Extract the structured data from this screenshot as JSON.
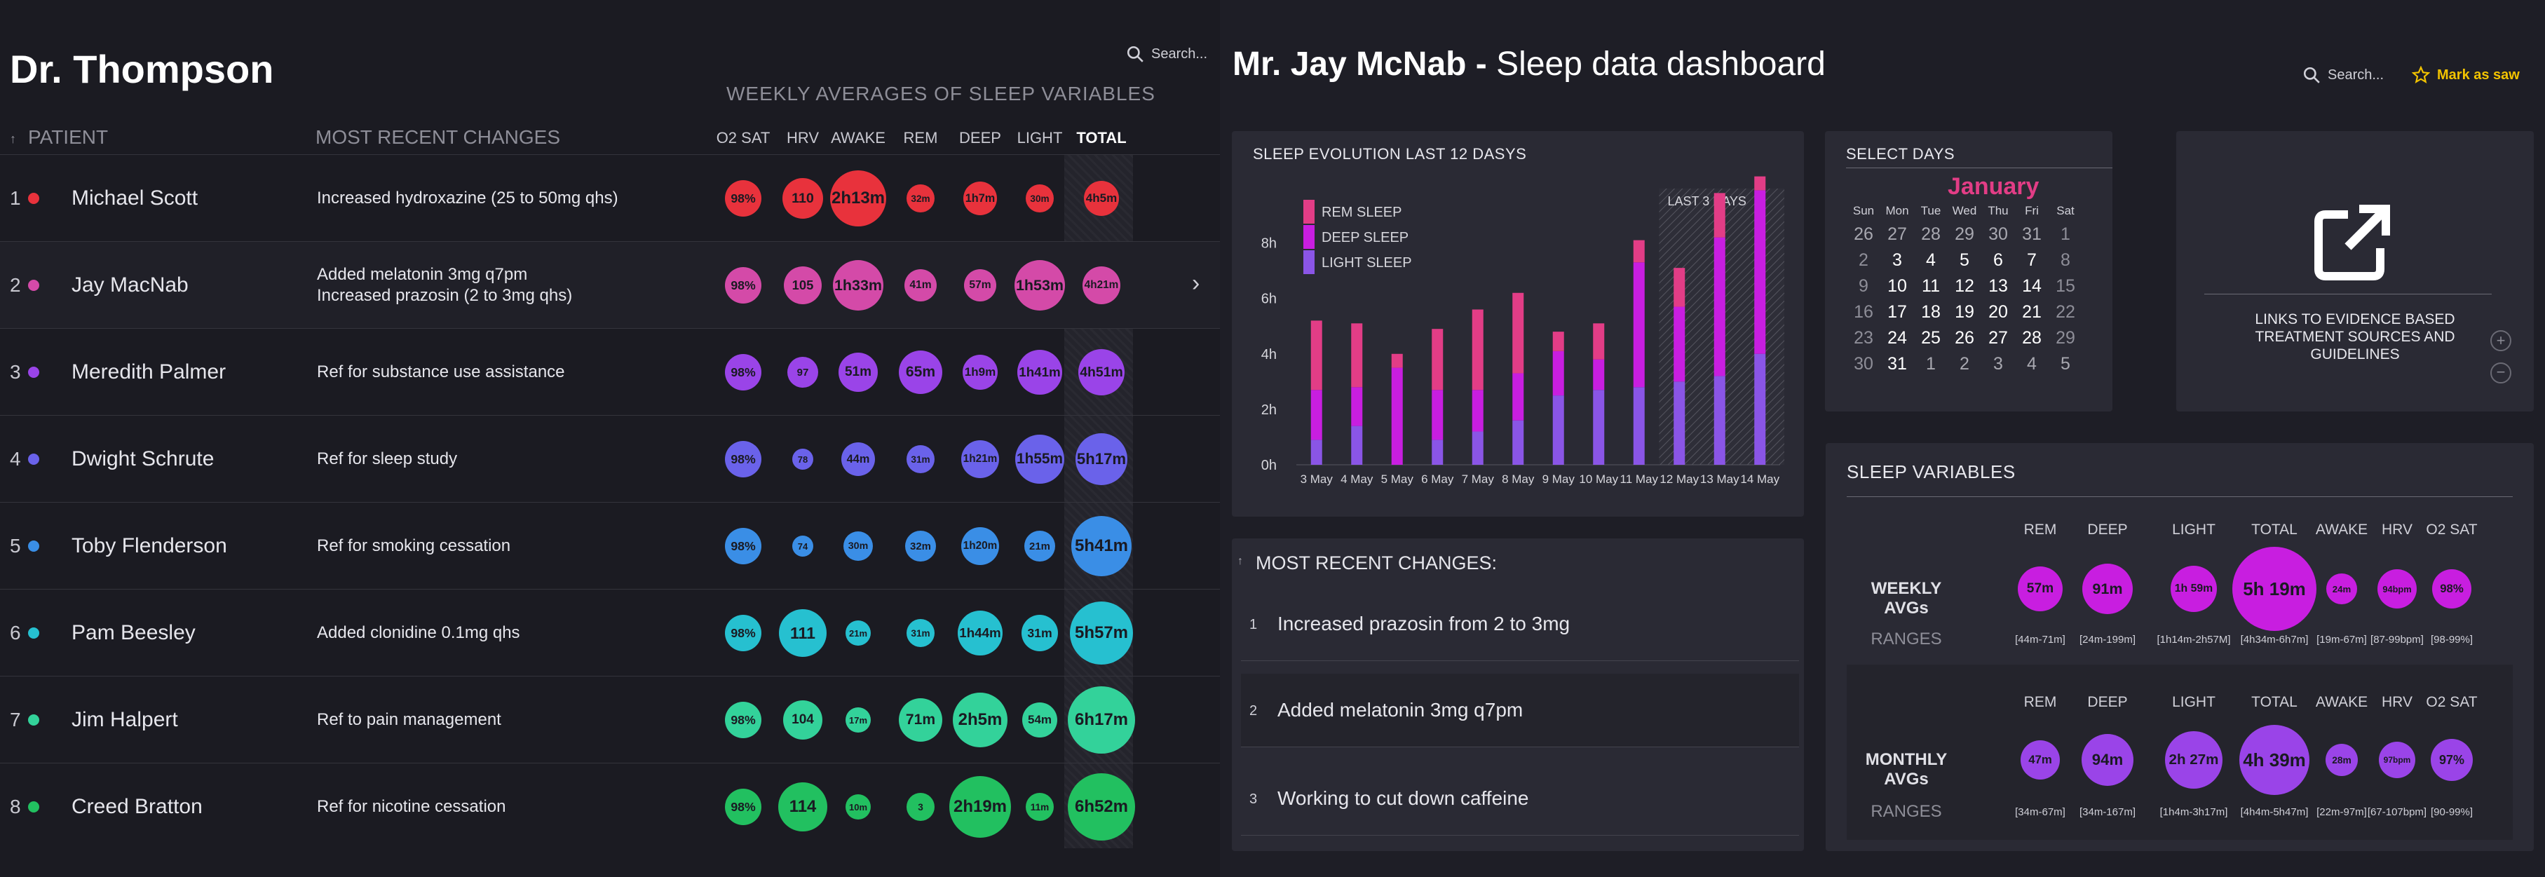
{
  "doctor": {
    "title": "Dr. Thompson",
    "search_placeholder": "Search..."
  },
  "weekly_title": "WEEKLY AVERAGES OF SLEEP VARIABLES",
  "columns": {
    "patient": "PATIENT",
    "changes": "MOST RECENT CHANGES",
    "sort_arrow": "↑"
  },
  "variables": [
    "O2 SAT",
    "HRV",
    "AWAKE",
    "REM",
    "DEEP",
    "LIGHT",
    "TOTAL"
  ],
  "patients": [
    {
      "num": "1",
      "name": "Michael Scott",
      "color": "#e8323c",
      "changes": [
        "Increased hydroxazine (25 to 50mg qhs)"
      ],
      "values": [
        "98%",
        "110",
        "2h13m",
        "32m",
        "1h7m",
        "30m",
        "4h5m"
      ]
    },
    {
      "num": "2",
      "name": "Jay MacNab",
      "color": "#d44aa8",
      "changes": [
        "Added melatonin 3mg q7pm",
        "Increased prazosin (2 to 3mg qhs)"
      ],
      "values": [
        "98%",
        "105",
        "1h33m",
        "41m",
        "57m",
        "1h53m",
        "4h21m"
      ]
    },
    {
      "num": "3",
      "name": "Meredith Palmer",
      "color": "#9a44e8",
      "changes": [
        "Ref for substance use assistance"
      ],
      "values": [
        "98%",
        "97",
        "51m",
        "65m",
        "1h9m",
        "1h41m",
        "4h51m"
      ]
    },
    {
      "num": "4",
      "name": "Dwight Schrute",
      "color": "#6a62ea",
      "changes": [
        "Ref for sleep study"
      ],
      "values": [
        "98%",
        "78",
        "44m",
        "31m",
        "1h21m",
        "1h55m",
        "5h17m"
      ]
    },
    {
      "num": "5",
      "name": "Toby Flenderson",
      "color": "#3a8ee6",
      "changes": [
        "Ref for smoking cessation"
      ],
      "values": [
        "98%",
        "74",
        "30m",
        "32m",
        "1h20m",
        "21m",
        "5h41m"
      ]
    },
    {
      "num": "6",
      "name": "Pam Beesley",
      "color": "#26c0d0",
      "changes": [
        "Added clonidine 0.1mg qhs"
      ],
      "values": [
        "98%",
        "111",
        "21m",
        "31m",
        "1h44m",
        "31m",
        "5h57m"
      ]
    },
    {
      "num": "7",
      "name": "Jim Halpert",
      "color": "#33d29a",
      "changes": [
        "Ref to pain management"
      ],
      "values": [
        "98%",
        "104",
        "17m",
        "71m",
        "2h5m",
        "54m",
        "6h17m"
      ]
    },
    {
      "num": "8",
      "name": "Creed Bratton",
      "color": "#22c060",
      "changes": [
        "Ref for nicotine cessation"
      ],
      "values": [
        "98%",
        "114",
        "10m",
        "3",
        "2h19m",
        "11m",
        "6h52m"
      ]
    }
  ],
  "dashboard": {
    "patient_name": "Mr. Jay McNab -",
    "subtitle": "Sleep data dashboard",
    "search_placeholder": "Search...",
    "mark_as_saw": "Mark as saw",
    "accent": "#f2c300"
  },
  "sleep_evolution": {
    "title": "SLEEP EVOLUTION LAST 12 DASYS",
    "last3": "LAST 3 DAYS",
    "legend": [
      {
        "label": "REM SLEEP",
        "color": "#e23d86"
      },
      {
        "label": "DEEP SLEEP",
        "color": "#c81ee0"
      },
      {
        "label": "LIGHT SLEEP",
        "color": "#8a55e6"
      }
    ],
    "ytick_labels": [
      "0h",
      "2h",
      "4h",
      "6h",
      "8h"
    ]
  },
  "chart_data": {
    "type": "bar",
    "title": "SLEEP EVOLUTION LAST 12 DASYS",
    "categories": [
      "3 May",
      "4 May",
      "5 May",
      "6 May",
      "7 May",
      "8 May",
      "9 May",
      "10 May",
      "11 May",
      "12 May",
      "13 May",
      "14 May"
    ],
    "series": [
      {
        "name": "LIGHT SLEEP",
        "values": [
          0.9,
          1.4,
          0,
          0.9,
          1.2,
          1.6,
          2.5,
          2.7,
          2.8,
          3.0,
          3.2,
          4.0
        ]
      },
      {
        "name": "DEEP SLEEP",
        "values": [
          1.8,
          1.4,
          3.5,
          1.8,
          1.5,
          1.7,
          1.6,
          1.1,
          4.5,
          2.7,
          5.0,
          5.9
        ]
      },
      {
        "name": "REM SLEEP",
        "values": [
          2.5,
          2.3,
          0.5,
          2.2,
          2.9,
          2.9,
          0.7,
          1.3,
          0.8,
          1.4,
          1.6,
          0.5
        ]
      }
    ],
    "ylim": [
      0,
      9
    ],
    "stacked": true,
    "annotation": "LAST 3 DAYS"
  },
  "calendar": {
    "title": "SELECT DAYS",
    "month": "January",
    "day_heads": [
      "Sun",
      "Mon",
      "Tue",
      "Wed",
      "Thu",
      "Fri",
      "Sat"
    ],
    "weeks": [
      [
        "26",
        "27",
        "28",
        "29",
        "30",
        "31",
        "1"
      ],
      [
        "2",
        "3",
        "4",
        "5",
        "6",
        "7",
        "8"
      ],
      [
        "9",
        "10",
        "11",
        "12",
        "13",
        "14",
        "15"
      ],
      [
        "16",
        "17",
        "18",
        "19",
        "20",
        "21",
        "22"
      ],
      [
        "23",
        "24",
        "25",
        "26",
        "27",
        "28",
        "29"
      ],
      [
        "30",
        "31",
        "1",
        "2",
        "3",
        "4",
        "5"
      ]
    ]
  },
  "links": {
    "text": "LINKS TO EVIDENCE BASED TREATMENT SOURCES AND GUIDELINES"
  },
  "changes_panel": {
    "title": "MOST RECENT CHANGES:",
    "sort_arrow": "↑",
    "items": [
      {
        "num": "1",
        "text": "Increased prazosin from 2 to 3mg"
      },
      {
        "num": "2",
        "text": "Added melatonin 3mg q7pm"
      },
      {
        "num": "3",
        "text": "Working to cut down caffeine"
      }
    ]
  },
  "sleep_variables": {
    "title": "SLEEP VARIABLES",
    "heads": [
      "REM",
      "DEEP",
      "LIGHT",
      "TOTAL",
      "AWAKE",
      "HRV",
      "O2 SAT"
    ],
    "weekly": {
      "label": "WEEKLY AVGs",
      "ranges_label": "RANGES",
      "color": "#c81ee0",
      "values": [
        "57m",
        "91m",
        "1h 59m",
        "5h 19m",
        "24m",
        "94bpm",
        "98%"
      ],
      "ranges": [
        "[44m-71m]",
        "[24m-199m]",
        "[1h14m-2h57M]",
        "[4h34m-6h7m]",
        "[19m-67m]",
        "[87-99bpm]",
        "[98-99%]"
      ]
    },
    "monthly": {
      "label": "MONTHLY AVGs",
      "ranges_label": "RANGES",
      "color": "#9a44e8",
      "values": [
        "47m",
        "94m",
        "2h 27m",
        "4h 39m",
        "28m",
        "97bpm",
        "97%"
      ],
      "ranges": [
        "[34m-67m]",
        "[34m-167m]",
        "[1h4m-3h17m]",
        "[4h4m-5h47m]",
        "[22m-97m]",
        "[67-107bpm]",
        "[90-99%]"
      ]
    }
  }
}
